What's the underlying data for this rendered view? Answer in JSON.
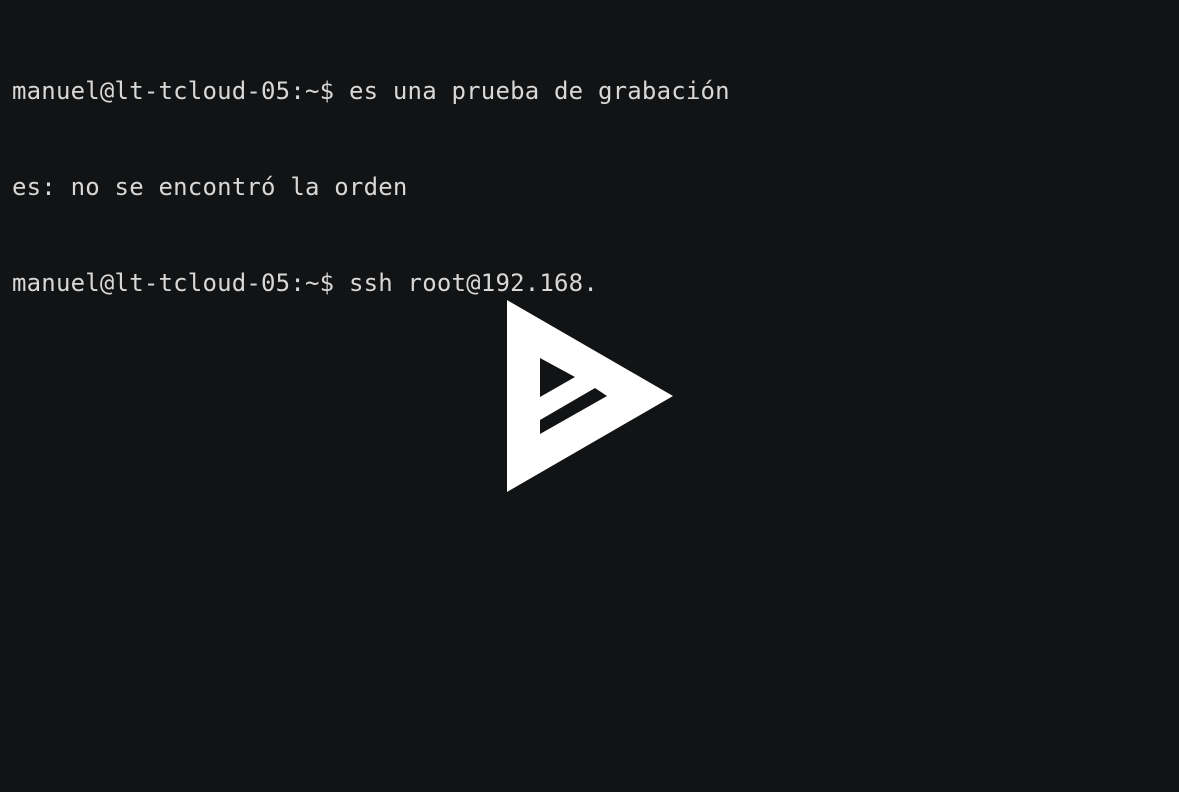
{
  "terminal": {
    "lines": [
      {
        "prompt": "manuel@lt-tcloud-05:~$",
        "command": " es una prueba de grabación"
      },
      {
        "output": "es: no se encontró la orden"
      },
      {
        "prompt": "manuel@lt-tcloud-05:~$",
        "command": " ssh root@192.168."
      }
    ]
  },
  "player": {
    "overlay_icon": "asciinema-play-icon",
    "background_color": "#121314",
    "text_color": "#d8d8d8",
    "icon_color": "#ffffff"
  }
}
